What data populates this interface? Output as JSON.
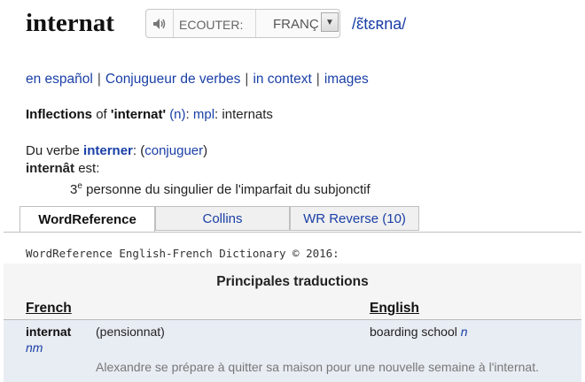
{
  "header": {
    "headword": "internat",
    "listen_label": "ECOUTER:",
    "language_select": "FRANÇ",
    "pronunciation": "/ɛ̃tɛʀna/"
  },
  "links": [
    "en español",
    "Conjugueur de verbes",
    "in context",
    "images"
  ],
  "inflections": {
    "label": "Inflections",
    "of": "of",
    "word": "'internat'",
    "pos": "(n)",
    "form_label": "mpl",
    "forms": "internats"
  },
  "verb": {
    "prefix": "Du verbe",
    "verb": "interner",
    "conjuguer": "conjuguer",
    "form_word": "internât",
    "form_suffix": "est:",
    "description_num": "3",
    "description_sup": "e",
    "description_rest": "personne du singulier de l'imparfait du subjonctif"
  },
  "tabs": [
    {
      "label": "WordReference",
      "active": true
    },
    {
      "label": "Collins",
      "active": false
    },
    {
      "label": "WR Reverse (10)",
      "active": false
    }
  ],
  "dictionary": {
    "copyright": "WordReference English-French Dictionary © 2016:",
    "section_title": "Principales traductions",
    "col_french": "French",
    "col_english": "English",
    "entry": {
      "word": "internat",
      "pos": "nm",
      "sense": "(pensionnat)",
      "translation": "boarding school",
      "translation_pos": "n",
      "example": "Alexandre se prépare à quitter sa maison pour une nouvelle semaine à l'internat."
    }
  },
  "colors": {
    "link": "#1a3fa6",
    "row_highlight": "#e8ecf3",
    "strip": "#f5f5f5"
  }
}
